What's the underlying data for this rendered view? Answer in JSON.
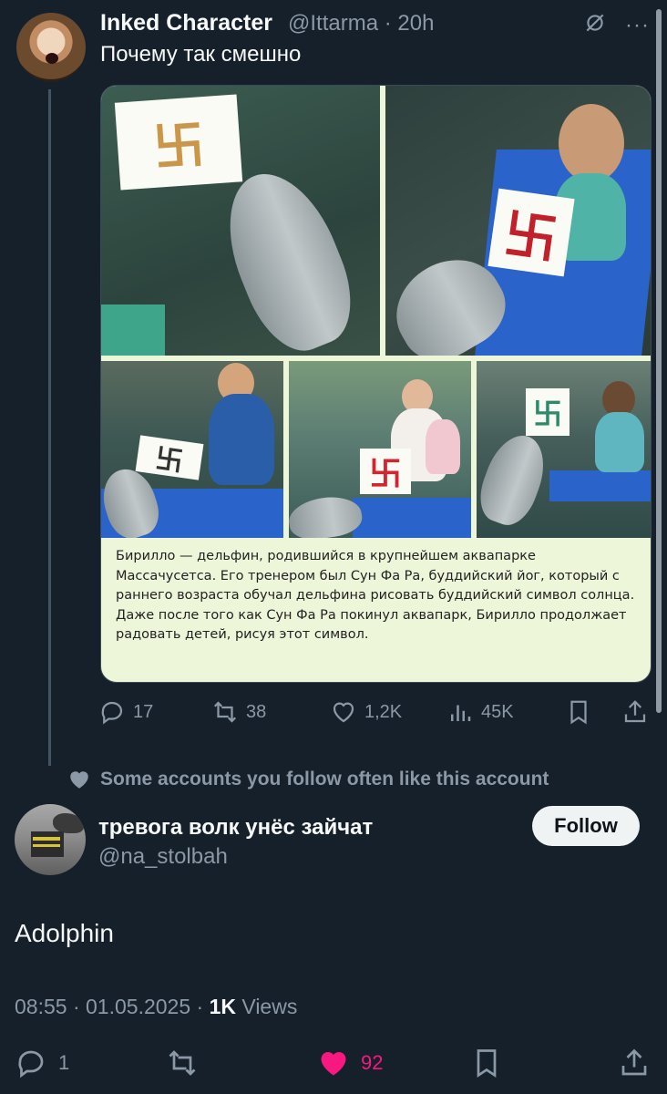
{
  "quoted": {
    "name": "Inked Character",
    "handle": "@Ittarma",
    "time": "20h",
    "text": "Почему так смешно",
    "caption": "Бирилло — дельфин, родившийся в крупнейшем аквапарке Массачусетса. Его тренером был Сун Фа Ра, буддийский йог, который с раннего возраста обучал дельфина рисовать буддийский символ солнца. Даже после того как Сун Фа Ра покинул аквапарк, Бирилло продолжает радовать детей, рисуя этот символ.",
    "stats": {
      "replies": "17",
      "reposts": "38",
      "likes": "1,2K",
      "views": "45K"
    }
  },
  "social_context": "Some accounts you follow often like this account",
  "post": {
    "name": "тревога волк унёс зайчат",
    "handle": "@na_stolbah",
    "follow_label": "Follow",
    "text": "Adolphin",
    "time": "08:55",
    "date": "01.05.2025",
    "views_count": "1K",
    "views_label": "Views",
    "stats": {
      "replies": "1",
      "likes": "92"
    }
  },
  "colors": {
    "background": "#15202b",
    "muted": "#8b98a5",
    "like": "#f91880"
  }
}
